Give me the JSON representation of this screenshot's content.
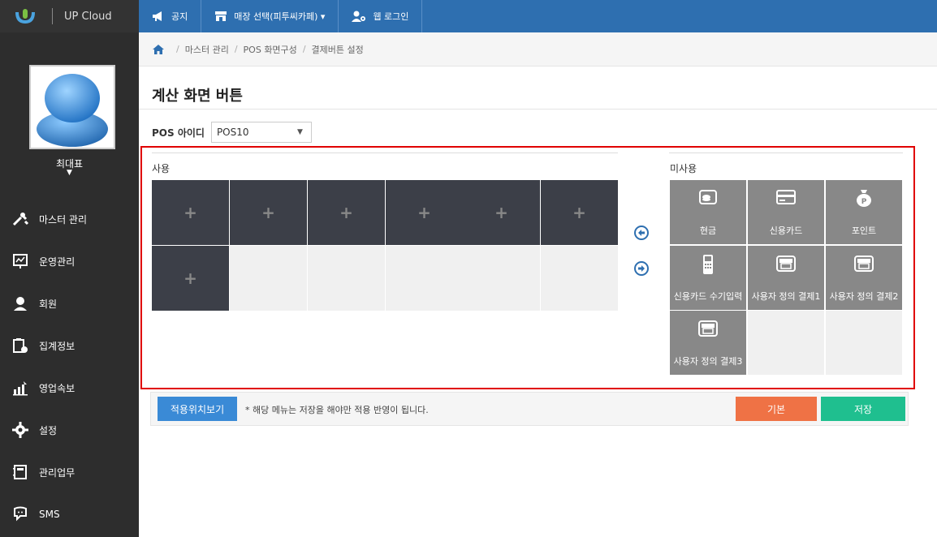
{
  "brand": {
    "name": "UP Cloud"
  },
  "user": {
    "name": "최대표",
    "caret": "▼"
  },
  "sidebar": {
    "items": [
      {
        "label": "마스터 관리",
        "icon": "wrench-icon"
      },
      {
        "label": "운영관리",
        "icon": "chart-board-icon"
      },
      {
        "label": "회원",
        "icon": "user-icon"
      },
      {
        "label": "집계정보",
        "icon": "clipboard-pie-icon"
      },
      {
        "label": "영업속보",
        "icon": "bar-chart-up-icon"
      },
      {
        "label": "설정",
        "icon": "gear-icon"
      },
      {
        "label": "관리업무",
        "icon": "notebook-icon"
      },
      {
        "label": "SMS",
        "icon": "phone-chat-icon"
      }
    ]
  },
  "topbar": {
    "notice": "공지",
    "store": "매장 선택(피투씨카페) ▾",
    "web_login": "웹 로그인"
  },
  "breadcrumb": [
    "마스터 관리",
    "POS 화면구성",
    "결제버튼 설정"
  ],
  "page": {
    "title": "계산 화면 버튼"
  },
  "pos": {
    "label": "POS 아이디",
    "selected": "POS10"
  },
  "used": {
    "title": "사용",
    "plus": "+"
  },
  "unused": {
    "title": "미사용",
    "items": [
      {
        "label": "현금",
        "icon": "cash-icon"
      },
      {
        "label": "신용카드",
        "icon": "credit-card-icon"
      },
      {
        "label": "포인트",
        "icon": "point-bag-icon"
      },
      {
        "label": "신용카드 수기입력",
        "icon": "card-terminal-icon"
      },
      {
        "label": "사용자 정의 결제1",
        "icon": "store-icon"
      },
      {
        "label": "사용자 정의 결제2",
        "icon": "store-icon"
      },
      {
        "label": "사용자 정의 결제3",
        "icon": "store-icon"
      }
    ]
  },
  "bottom": {
    "preview_button": "적용위치보기",
    "note": "* 해당 메뉴는 저장을 해야만 적용 반영이 됩니다.",
    "default_button": "기본",
    "save_button": "저장"
  },
  "colors": {
    "sidebar_bg": "#2d2d2d",
    "topbar_bg": "#2e6fb0",
    "highlight_border": "#e00000",
    "used_button": "#3c3f48",
    "unused_button": "#888888",
    "preview_button": "#3a8ad6",
    "default_button": "#ef7245",
    "save_button": "#1fbf8f"
  }
}
